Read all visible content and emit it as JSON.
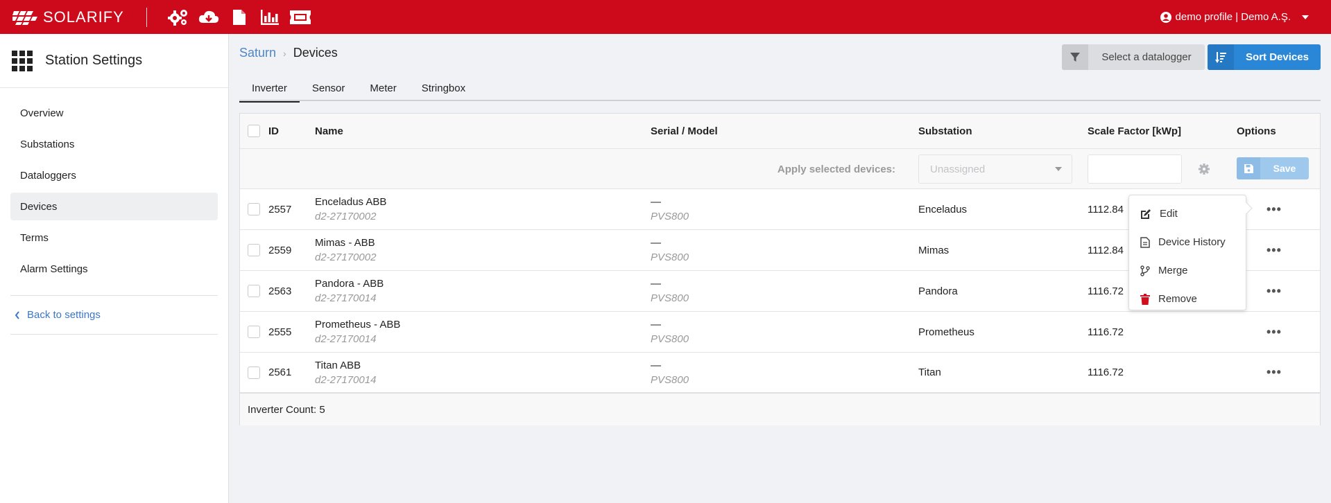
{
  "header": {
    "logo_text": "SOLARIFY",
    "icons": [
      "gears-icon",
      "cloud-download-icon",
      "file-icon",
      "chart-icon",
      "ticket-icon"
    ],
    "profile_label": "demo profile | Demo A.Ş."
  },
  "sidebar": {
    "title": "Station Settings",
    "items": [
      {
        "label": "Overview",
        "active": false
      },
      {
        "label": "Substations",
        "active": false
      },
      {
        "label": "Dataloggers",
        "active": false
      },
      {
        "label": "Devices",
        "active": true
      },
      {
        "label": "Terms",
        "active": false
      },
      {
        "label": "Alarm Settings",
        "active": false
      }
    ],
    "back_label": "Back to settings"
  },
  "breadcrumb": {
    "parent": "Saturn",
    "current": "Devices"
  },
  "toolbar": {
    "datalogger_label": "Select a datalogger",
    "sort_label": "Sort Devices"
  },
  "tabs": [
    {
      "label": "Inverter",
      "active": true
    },
    {
      "label": "Sensor",
      "active": false
    },
    {
      "label": "Meter",
      "active": false
    },
    {
      "label": "Stringbox",
      "active": false
    }
  ],
  "table": {
    "columns": {
      "id": "ID",
      "name": "Name",
      "serial": "Serial / Model",
      "substation": "Substation",
      "scale": "Scale Factor [kWp]",
      "options": "Options"
    },
    "apply": {
      "label": "Apply selected devices:",
      "select_value": "Unassigned",
      "save_label": "Save"
    },
    "rows": [
      {
        "id": "2557",
        "name": "Enceladus ABB",
        "code": "d2-27170002",
        "serial": "—",
        "model": "PVS800",
        "substation": "Enceladus",
        "scale": "1112.84"
      },
      {
        "id": "2559",
        "name": "Mimas - ABB",
        "code": "d2-27170002",
        "serial": "—",
        "model": "PVS800",
        "substation": "Mimas",
        "scale": "1112.84"
      },
      {
        "id": "2563",
        "name": "Pandora - ABB",
        "code": "d2-27170014",
        "serial": "—",
        "model": "PVS800",
        "substation": "Pandora",
        "scale": "1116.72"
      },
      {
        "id": "2555",
        "name": "Prometheus - ABB",
        "code": "d2-27170014",
        "serial": "—",
        "model": "PVS800",
        "substation": "Prometheus",
        "scale": "1116.72"
      },
      {
        "id": "2561",
        "name": "Titan ABB",
        "code": "d2-27170014",
        "serial": "—",
        "model": "PVS800",
        "substation": "Titan",
        "scale": "1116.72"
      }
    ],
    "footer": "Inverter Count: 5"
  },
  "menu": {
    "items": [
      {
        "label": "Edit",
        "icon": "edit-icon"
      },
      {
        "label": "Device History",
        "icon": "file-text-icon"
      },
      {
        "label": "Merge",
        "icon": "merge-icon"
      },
      {
        "label": "Remove",
        "icon": "trash-icon"
      }
    ]
  },
  "colors": {
    "brand_red": "#cd0a1c",
    "accent_blue": "#2a86d7",
    "link_blue": "#3a77c9"
  }
}
